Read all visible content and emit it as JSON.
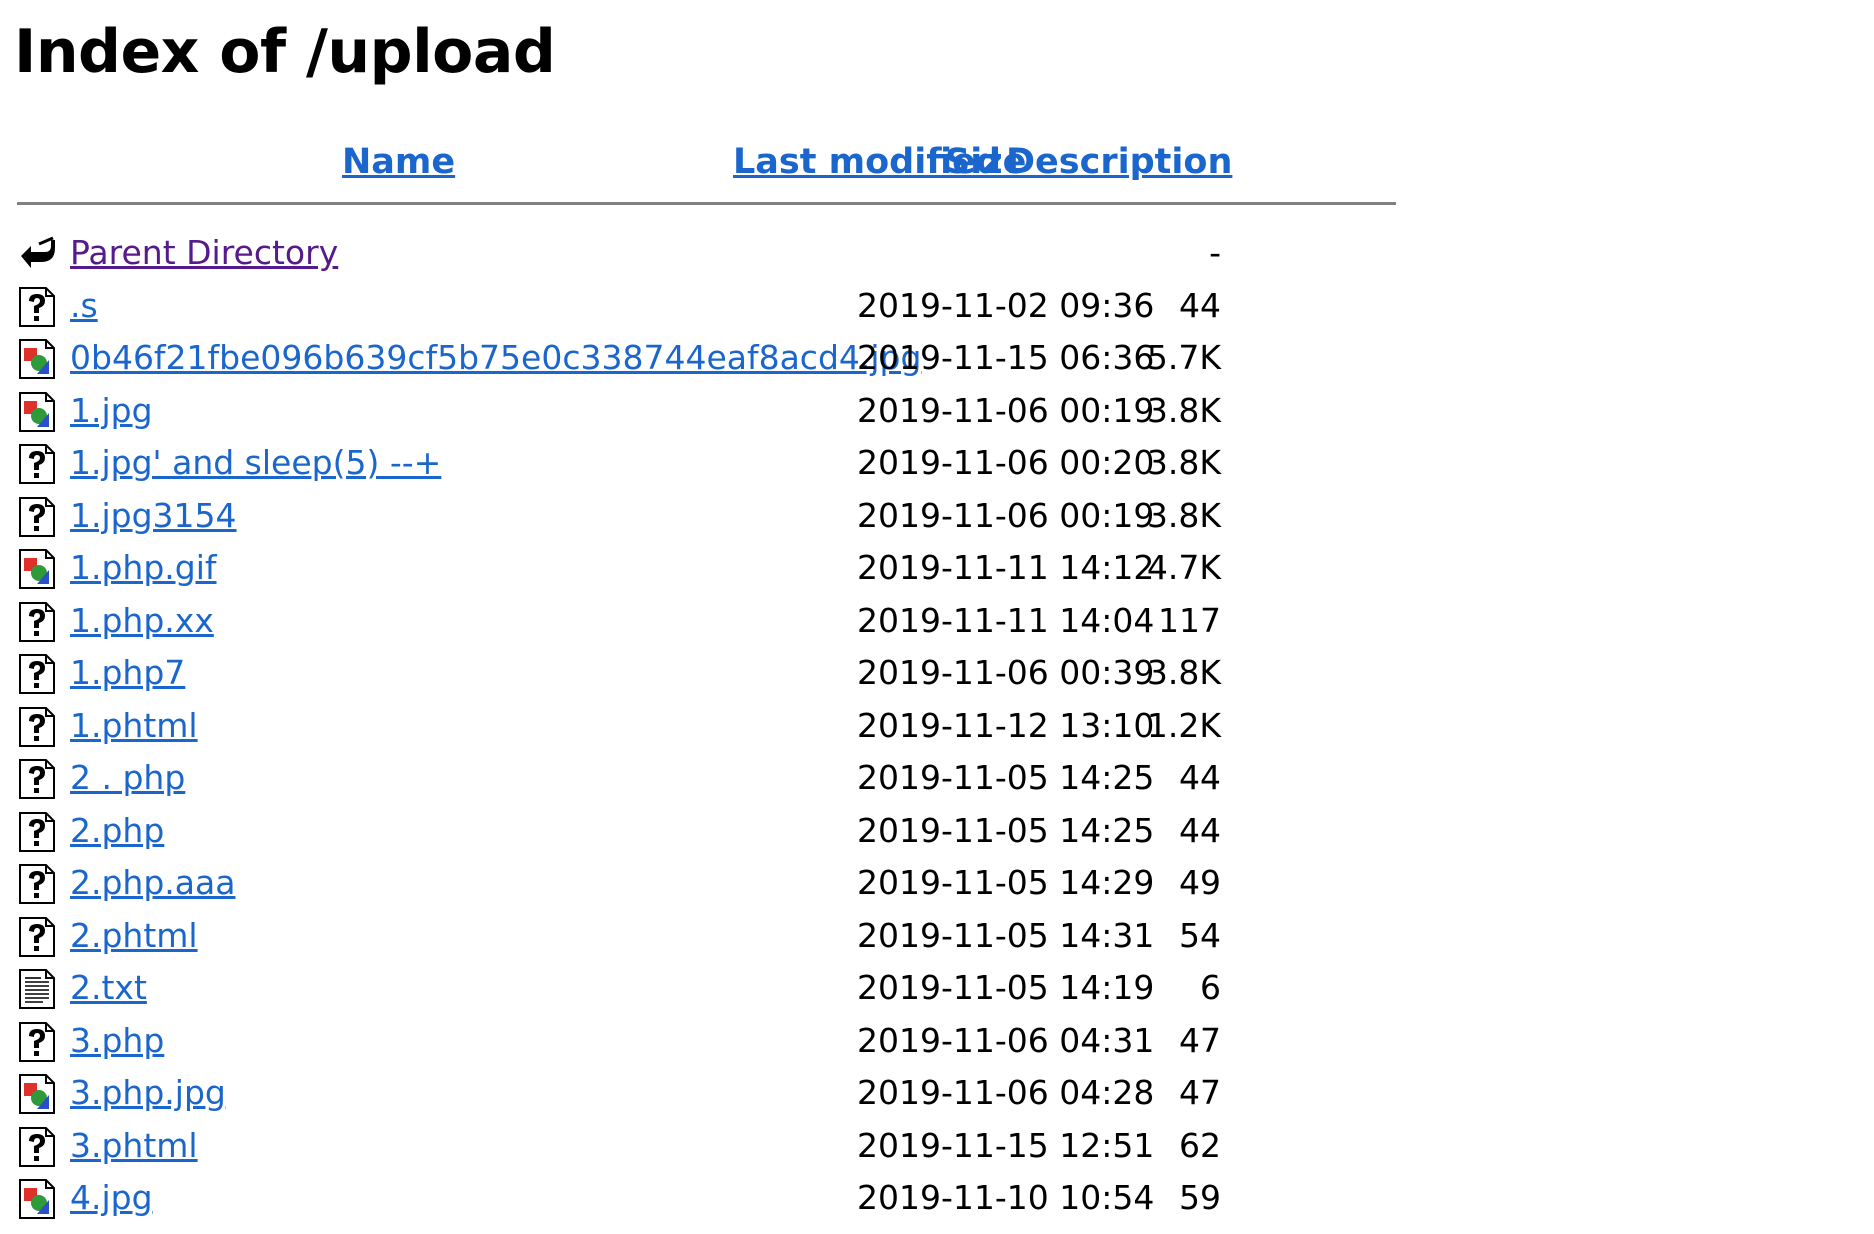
{
  "page": {
    "title": "Index of /upload"
  },
  "columns": {
    "name": "Name",
    "last_modified": "Last modified",
    "size": "Size",
    "description": "Description"
  },
  "rows": [
    {
      "icon": "back-icon",
      "name": "Parent Directory",
      "date": "",
      "size": "-"
    },
    {
      "icon": "unknown-file-icon",
      "name": ".s",
      "date": "2019-11-02 09:36",
      "size": "44"
    },
    {
      "icon": "image-file-icon",
      "name": "0b46f21fbe096b639cf5b75e0c338744eaf8acd4.jpg",
      "date": "2019-11-15 06:36",
      "size": "5.7K"
    },
    {
      "icon": "image-file-icon",
      "name": "1.jpg",
      "date": "2019-11-06 00:19",
      "size": "3.8K"
    },
    {
      "icon": "unknown-file-icon",
      "name": "1.jpg' and sleep(5) --+",
      "date": "2019-11-06 00:20",
      "size": "3.8K"
    },
    {
      "icon": "unknown-file-icon",
      "name": "1.jpg3154",
      "date": "2019-11-06 00:19",
      "size": "3.8K"
    },
    {
      "icon": "image-file-icon",
      "name": "1.php.gif",
      "date": "2019-11-11 14:12",
      "size": "4.7K"
    },
    {
      "icon": "unknown-file-icon",
      "name": "1.php.xx",
      "date": "2019-11-11 14:04",
      "size": "117"
    },
    {
      "icon": "unknown-file-icon",
      "name": "1.php7",
      "date": "2019-11-06 00:39",
      "size": "3.8K"
    },
    {
      "icon": "unknown-file-icon",
      "name": "1.phtml",
      "date": "2019-11-12 13:10",
      "size": "1.2K"
    },
    {
      "icon": "unknown-file-icon",
      "name": "2 . php",
      "date": "2019-11-05 14:25",
      "size": "44"
    },
    {
      "icon": "unknown-file-icon",
      "name": "2.php",
      "date": "2019-11-05 14:25",
      "size": "44"
    },
    {
      "icon": "unknown-file-icon",
      "name": "2.php.aaa",
      "date": "2019-11-05 14:29",
      "size": "49"
    },
    {
      "icon": "unknown-file-icon",
      "name": "2.phtml",
      "date": "2019-11-05 14:31",
      "size": "54"
    },
    {
      "icon": "text-file-icon",
      "name": "2.txt",
      "date": "2019-11-05 14:19",
      "size": "6"
    },
    {
      "icon": "unknown-file-icon",
      "name": "3.php",
      "date": "2019-11-06 04:31",
      "size": "47"
    },
    {
      "icon": "image-file-icon",
      "name": "3.php.jpg",
      "date": "2019-11-06 04:28",
      "size": "47"
    },
    {
      "icon": "unknown-file-icon",
      "name": "3.phtml",
      "date": "2019-11-15 12:51",
      "size": "62"
    },
    {
      "icon": "image-file-icon",
      "name": "4.jpg",
      "date": "2019-11-10 10:54",
      "size": "59"
    }
  ],
  "colors": {
    "link": "#1a66cc",
    "visited_link": "#551a8b",
    "rule": "#808080"
  }
}
